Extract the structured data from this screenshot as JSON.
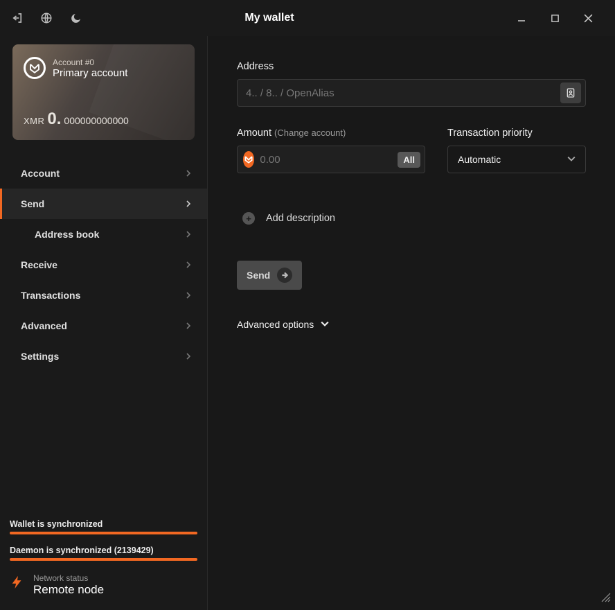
{
  "window": {
    "title": "My wallet"
  },
  "account_card": {
    "label": "Account #0",
    "name": "Primary account",
    "currency": "XMR",
    "balance_int": "0.",
    "balance_frac": "000000000000"
  },
  "nav": {
    "account": "Account",
    "send": "Send",
    "address_book": "Address book",
    "receive": "Receive",
    "transactions": "Transactions",
    "advanced": "Advanced",
    "settings": "Settings"
  },
  "status": {
    "wallet_sync": "Wallet is synchronized",
    "daemon_sync": "Daemon is synchronized (2139429)",
    "network_label": "Network status",
    "network_value": "Remote node"
  },
  "form": {
    "address_label": "Address",
    "address_placeholder": "4.. / 8.. / OpenAlias",
    "amount_label": "Amount",
    "amount_extra": "(Change account)",
    "amount_placeholder": "0.00",
    "all_btn": "All",
    "priority_label": "Transaction priority",
    "priority_value": "Automatic",
    "add_description": "Add description",
    "send_btn": "Send",
    "advanced_options": "Advanced options"
  }
}
